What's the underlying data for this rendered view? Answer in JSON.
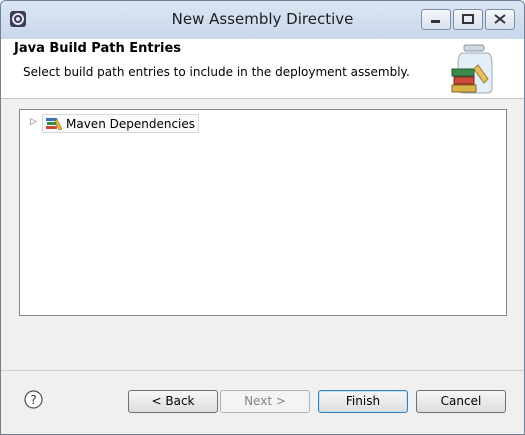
{
  "window": {
    "title": "New Assembly Directive"
  },
  "header": {
    "title": "Java Build Path Entries",
    "description": "Select build path entries to include in the deployment assembly."
  },
  "tree": {
    "items": [
      {
        "label": "Maven Dependencies",
        "expanded": false,
        "icon": "library-icon"
      }
    ]
  },
  "footer": {
    "back_label": "< Back",
    "next_label": "Next >",
    "finish_label": "Finish",
    "cancel_label": "Cancel"
  },
  "colors": {
    "titlebar": "#c8d7ea",
    "default_button_border": "#3c7fb1"
  }
}
